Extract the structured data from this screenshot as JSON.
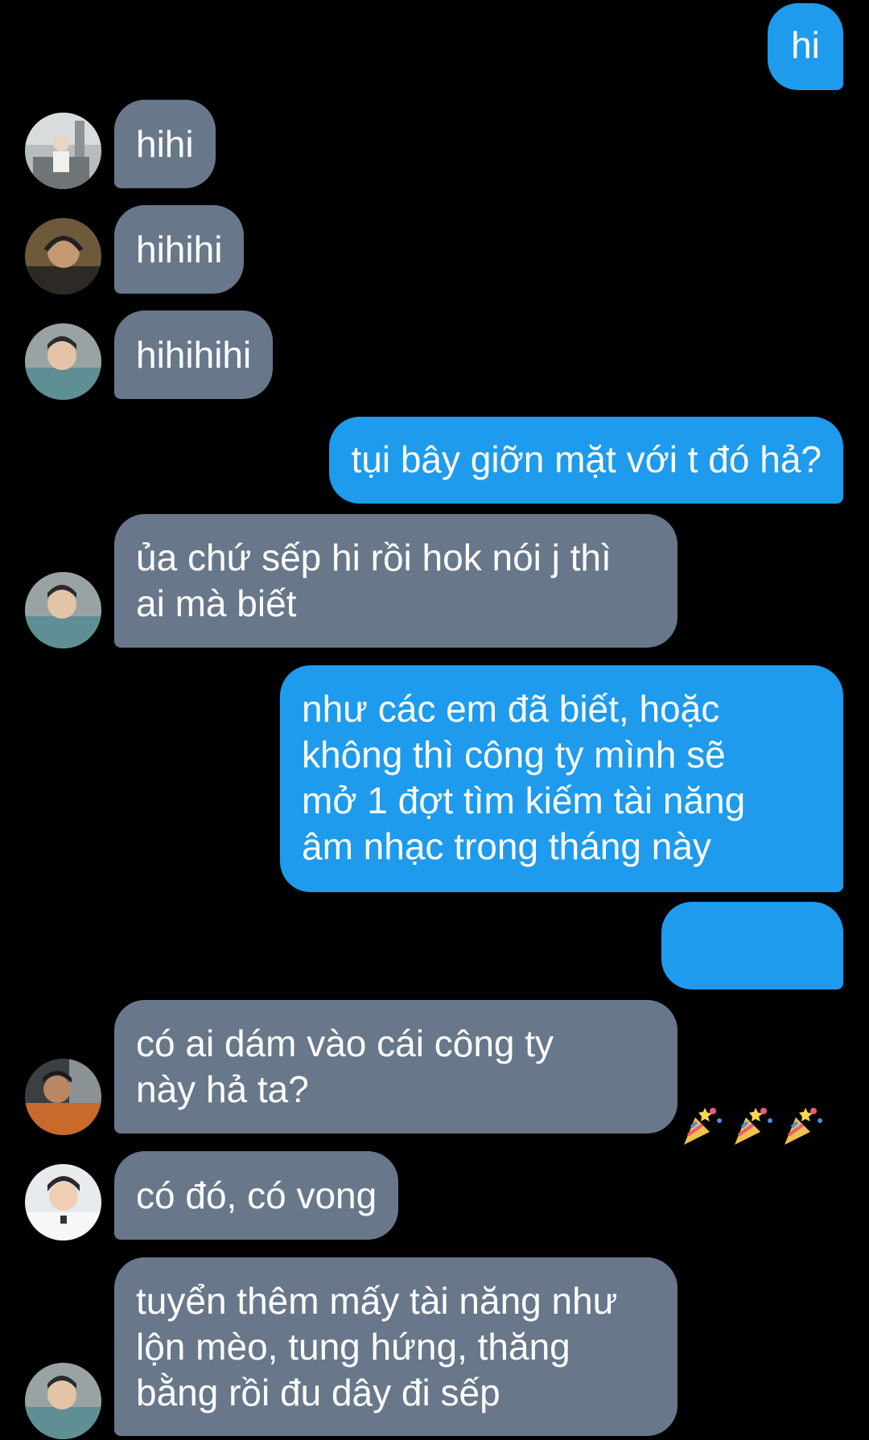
{
  "messages": [
    {
      "id": "m1",
      "direction": "sent",
      "text": "hi"
    },
    {
      "id": "m2",
      "direction": "received",
      "text": "hihi",
      "avatar": "user-a-avatar"
    },
    {
      "id": "m3",
      "direction": "received",
      "text": "hihihi",
      "avatar": "user-b-avatar"
    },
    {
      "id": "m4",
      "direction": "received",
      "text": "hihihihi",
      "avatar": "user-c-avatar"
    },
    {
      "id": "m5",
      "direction": "sent",
      "text": "tụi bây giỡn mặt với t đó hả?"
    },
    {
      "id": "m6",
      "direction": "received",
      "text": "ủa chứ sếp hi rồi hok nói j thì\nai mà biết",
      "avatar": "user-c-avatar"
    },
    {
      "id": "m7",
      "direction": "sent",
      "text": "như các em đã biết, hoặc\nkhông thì công ty mình sẽ\nmở 1 đợt tìm kiếm tài năng\nâm nhạc trong tháng này"
    },
    {
      "id": "m8",
      "direction": "sent",
      "emoji": [
        "party-popper-icon",
        "party-popper-icon",
        "party-popper-icon"
      ]
    },
    {
      "id": "m9",
      "direction": "received",
      "text": "có ai dám vào cái công ty\nnày hả ta?",
      "avatar": "user-d-avatar"
    },
    {
      "id": "m10",
      "direction": "received",
      "text": "có đó, có vong",
      "avatar": "user-e-avatar"
    },
    {
      "id": "m11",
      "direction": "received",
      "text": "tuyển thêm mấy tài năng như\nlộn mèo, tung hứng, thăng\nbằng rồi đu dây đi sếp",
      "avatar": "user-c-avatar"
    }
  ],
  "colors": {
    "background": "#000000",
    "sent_bubble": "#1e9bed",
    "received_bubble": "#68788a",
    "text": "#ffffff"
  }
}
